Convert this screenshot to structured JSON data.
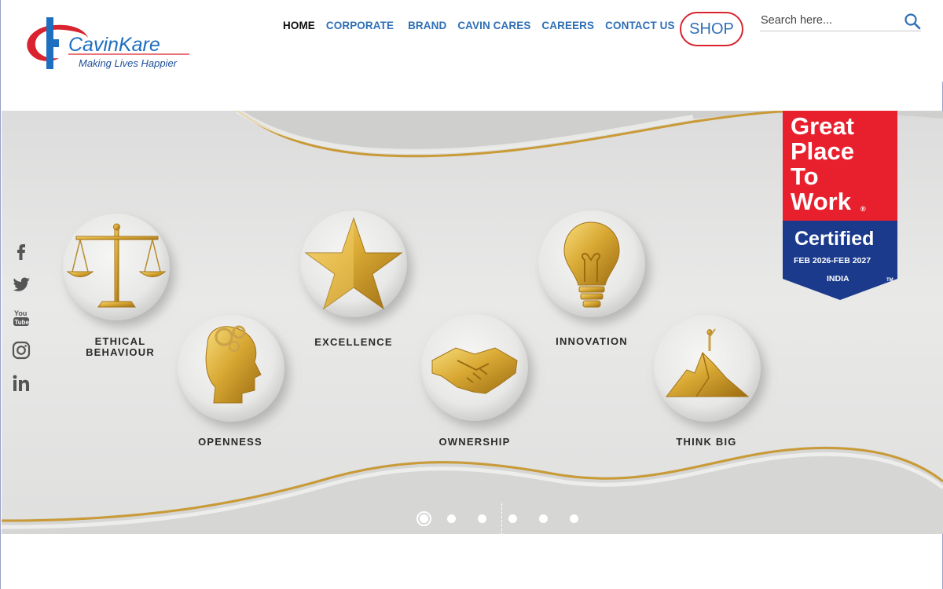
{
  "brand": {
    "name": "CavinKare",
    "tagline": "Making Lives Happier",
    "colors": {
      "red": "#d9232e",
      "blue": "#2f6fb5",
      "dark_blue": "#1e4f9a"
    }
  },
  "nav": {
    "items": [
      {
        "label": "HOME",
        "active": true
      },
      {
        "label": "CORPORATE",
        "active": false
      },
      {
        "label": "BRAND",
        "active": false
      },
      {
        "label": "CAVIN CARES",
        "active": false
      },
      {
        "label": "CAREERS",
        "active": false
      },
      {
        "label": "CONTACT US",
        "active": false
      }
    ],
    "shop_label": "SHOP"
  },
  "search": {
    "placeholder": "Search here...",
    "value": "",
    "icon": "search-icon"
  },
  "banner": {
    "values": [
      {
        "label_line1": "ETHICAL",
        "label_line2": "BEHAVIOUR",
        "icon": "scales-icon"
      },
      {
        "label_line1": "OPENNESS",
        "label_line2": "",
        "icon": "head-gears-icon"
      },
      {
        "label_line1": "EXCELLENCE",
        "label_line2": "",
        "icon": "star-icon"
      },
      {
        "label_line1": "OWNERSHIP",
        "label_line2": "",
        "icon": "handshake-icon"
      },
      {
        "label_line1": "INNOVATION",
        "label_line2": "",
        "icon": "lightbulb-icon"
      },
      {
        "label_line1": "THINK BIG",
        "label_line2": "",
        "icon": "mountain-icon"
      }
    ],
    "badge": {
      "line1": "Great",
      "line2": "Place",
      "line3": "To",
      "line4": "Work",
      "registered": "®",
      "certified": "Certified",
      "period": "FEB 2026-FEB 2027",
      "country": "INDIA",
      "tm": "TM",
      "colors": {
        "red": "#e8202e",
        "navy": "#1b3a8c"
      }
    },
    "slides_count": 6,
    "active_slide": 1
  },
  "social": [
    {
      "icon": "facebook-icon"
    },
    {
      "icon": "twitter-icon"
    },
    {
      "icon": "youtube-icon"
    },
    {
      "icon": "instagram-icon"
    },
    {
      "icon": "linkedin-icon"
    }
  ]
}
